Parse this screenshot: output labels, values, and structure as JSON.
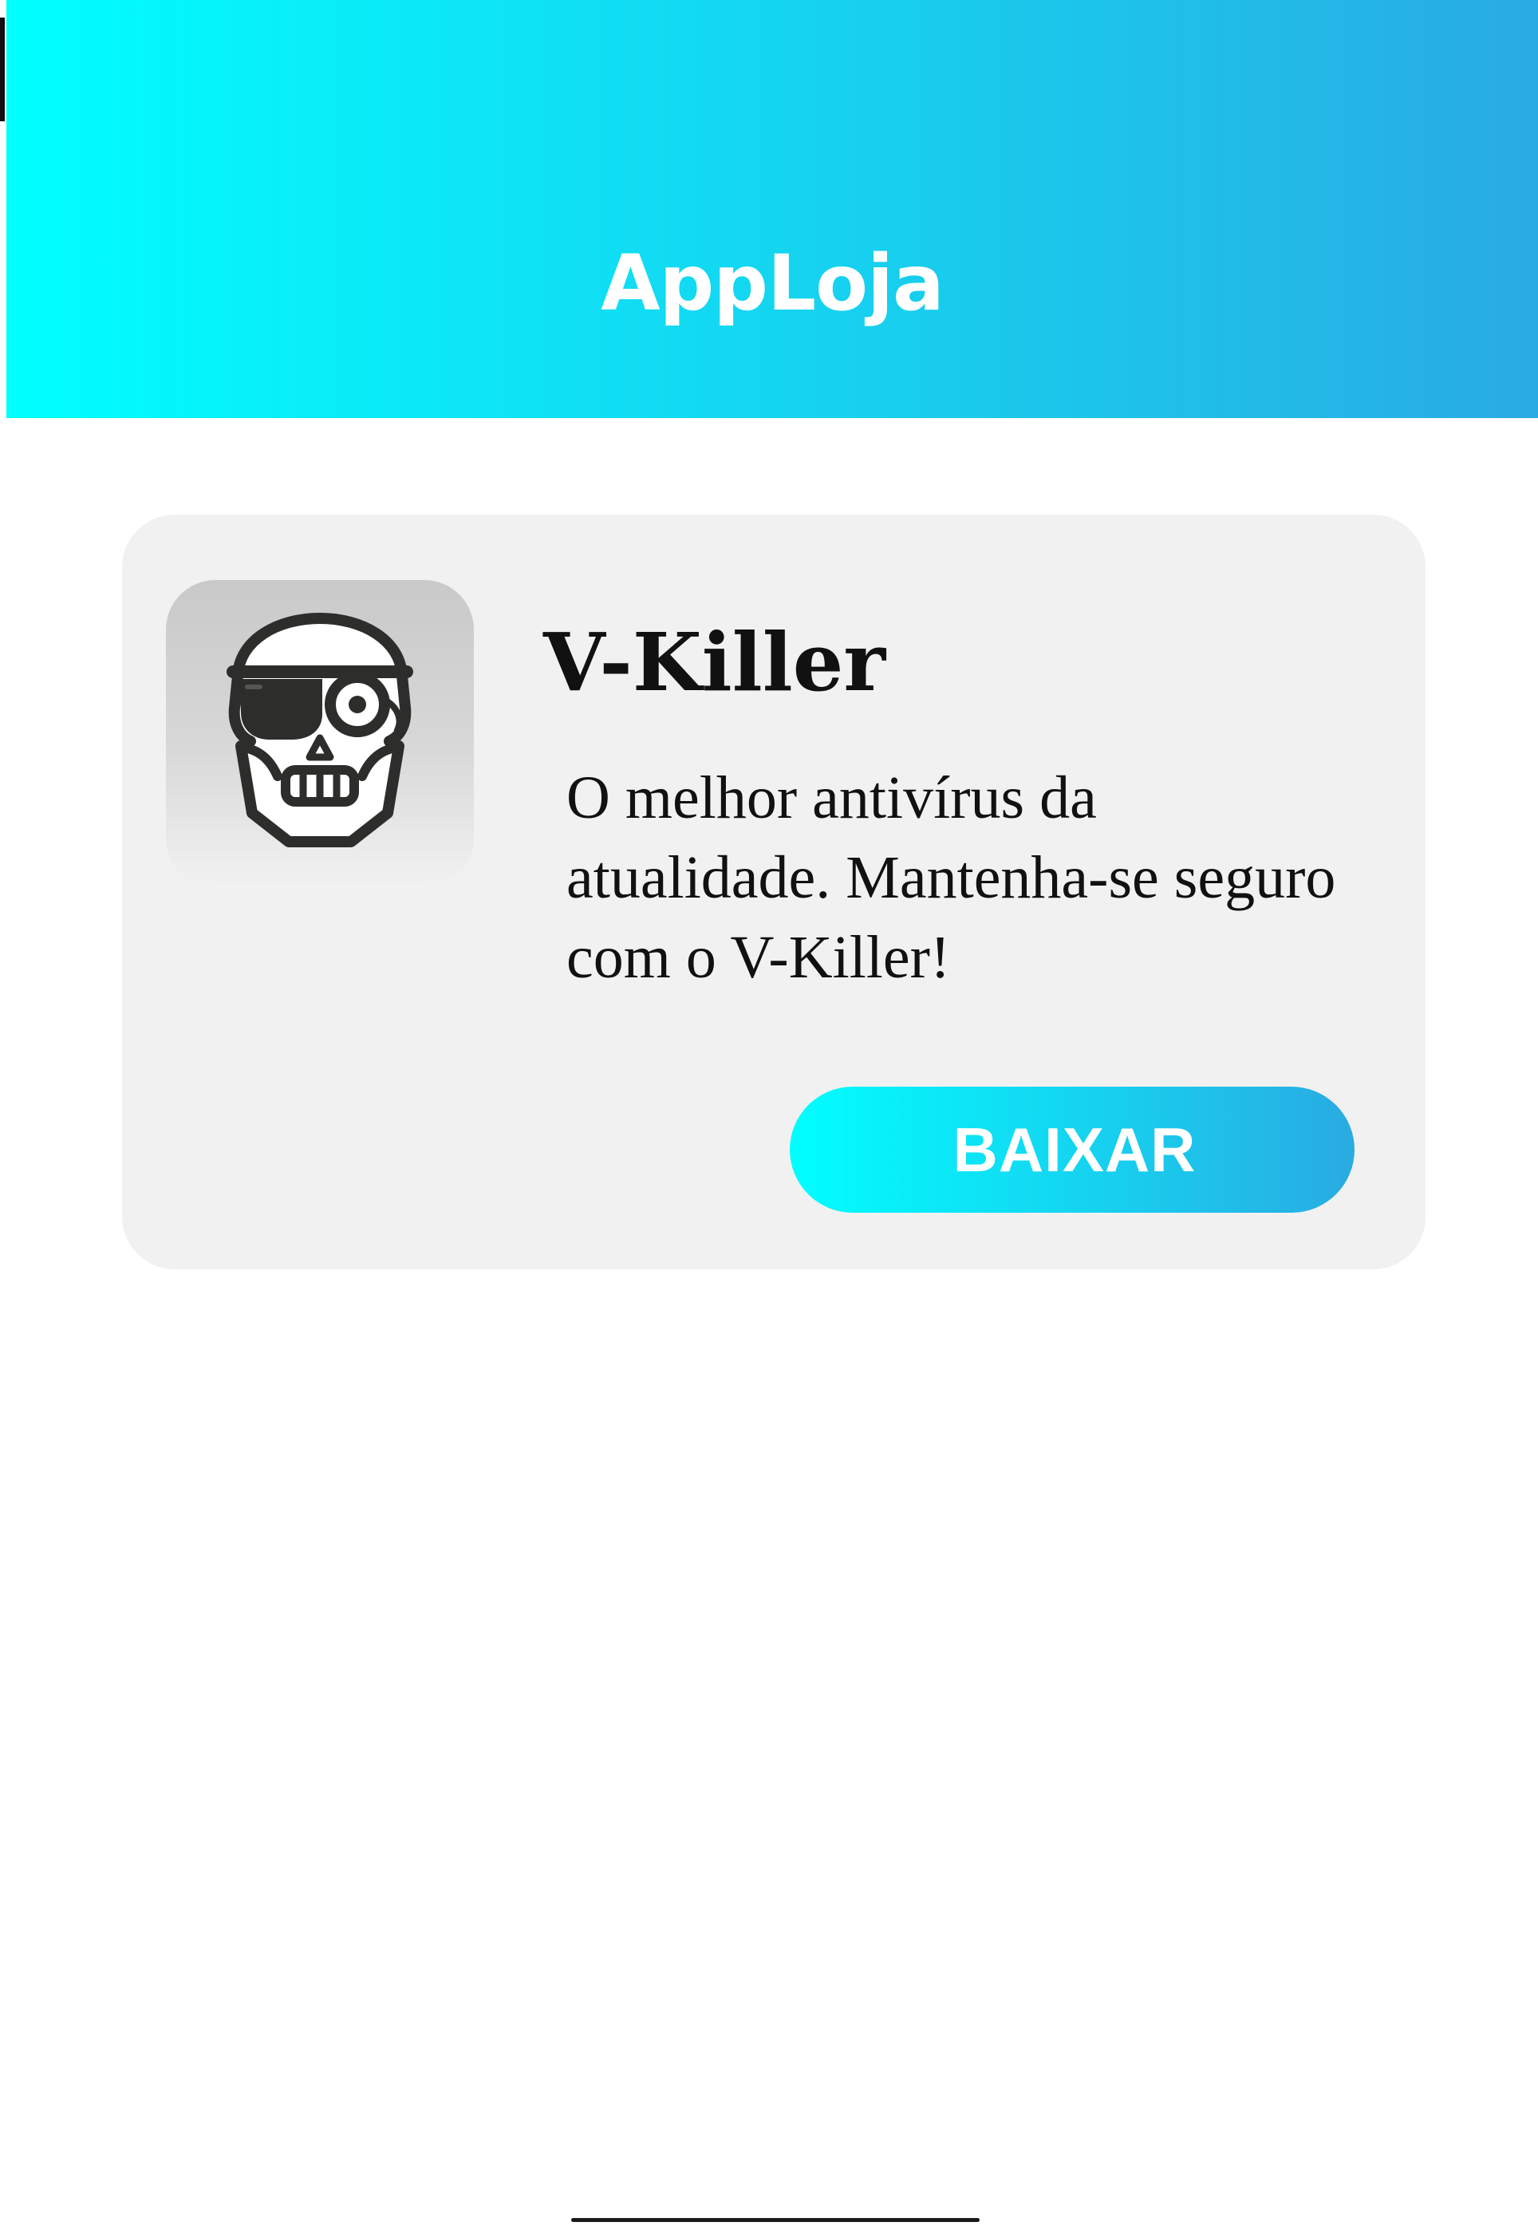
{
  "header": {
    "title": "AppLoja"
  },
  "app": {
    "name": "V-Killer",
    "description": "O melhor antivírus da atualidade. Mantenha-se seguro com o V-Killer!",
    "icon": "pirate-skull-icon",
    "download_label": "BAIXAR"
  },
  "colors": {
    "gradient_start": "#00ffff",
    "gradient_end": "#29abe2",
    "card_background": "#f1f1f1",
    "text": "#111111"
  }
}
